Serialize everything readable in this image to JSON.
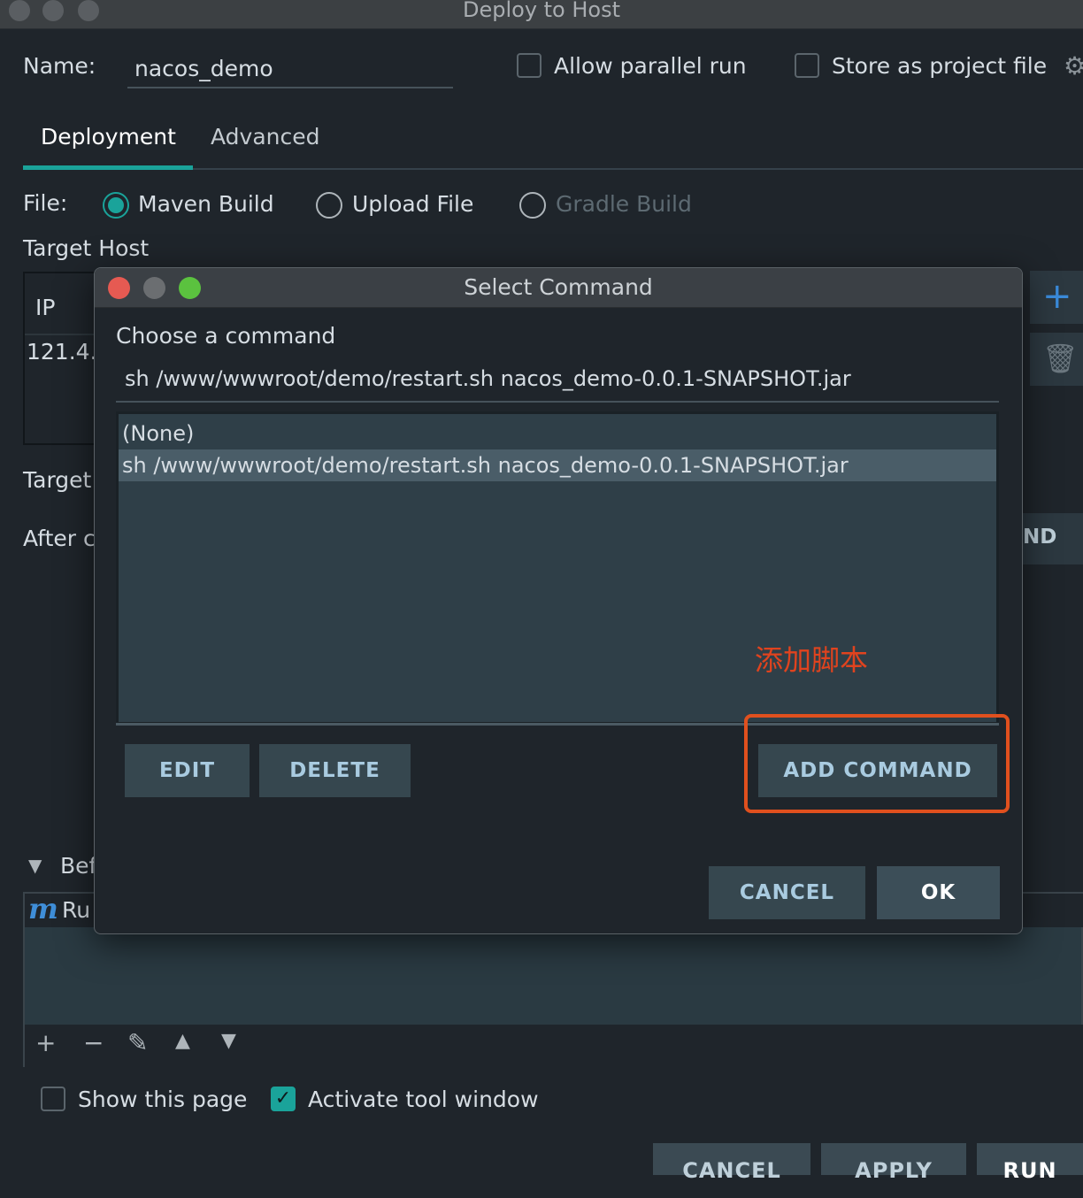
{
  "window": {
    "title": "Deploy to Host"
  },
  "form": {
    "name_label": "Name:",
    "name_value": "nacos_demo",
    "allow_parallel_label": "Allow parallel run",
    "store_project_label": "Store as project file"
  },
  "tabs": [
    {
      "label": "Deployment",
      "active": true
    },
    {
      "label": "Advanced",
      "active": false
    }
  ],
  "file": {
    "label": "File:",
    "options": [
      {
        "label": "Maven Build",
        "selected": true,
        "enabled": true
      },
      {
        "label": "Upload File",
        "selected": false,
        "enabled": true
      },
      {
        "label": "Gradle Build",
        "selected": false,
        "enabled": false
      }
    ]
  },
  "target_host": {
    "label": "Target Host",
    "col_ip": "IP",
    "row_ip": "121.4."
  },
  "partial_labels": {
    "target": "Target",
    "after": "After c",
    "before": "Bef",
    "before_item": "Ru",
    "add_command_suffix": "ND"
  },
  "bottom": {
    "show_page_label": "Show this page",
    "activate_tool_label": "Activate tool window",
    "cancel": "CANCEL",
    "apply": "APPLY",
    "run": "RUN"
  },
  "dialog": {
    "title": "Select Command",
    "prompt": "Choose a command",
    "command_value": "sh /www/wwwroot/demo/restart.sh nacos_demo-0.0.1-SNAPSHOT.jar",
    "items": [
      "(None)",
      "sh /www/wwwroot/demo/restart.sh nacos_demo-0.0.1-SNAPSHOT.jar"
    ],
    "selected_index": 1,
    "edit": "EDIT",
    "delete": "DELETE",
    "add_command": "ADD COMMAND",
    "cancel": "CANCEL",
    "ok": "OK"
  },
  "annotation": {
    "text": "添加脚本",
    "color": "#e0431e"
  },
  "colors": {
    "accent": "#1aa39a",
    "background": "#1f252b"
  }
}
